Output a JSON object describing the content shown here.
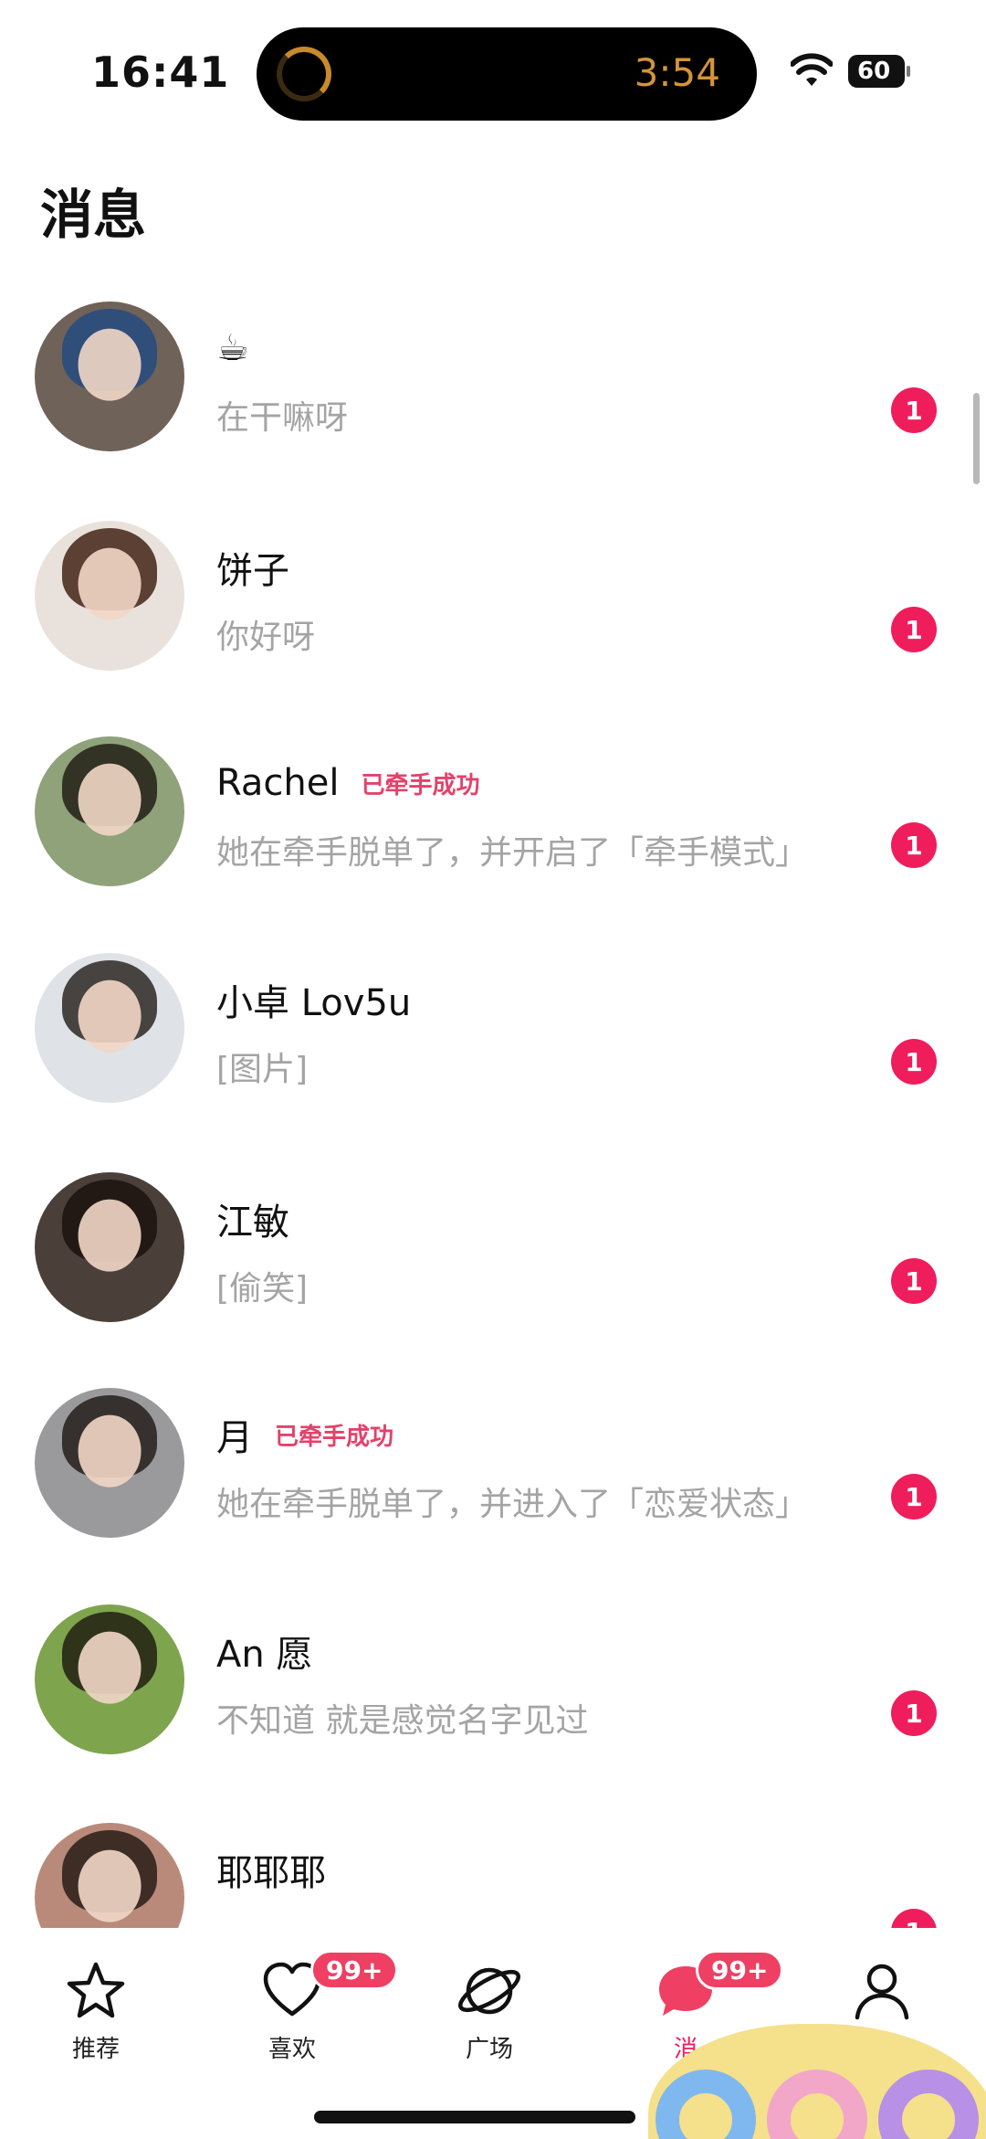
{
  "status_bar": {
    "time": "16:41",
    "live_activity_timer": "3:54",
    "battery_level": "60",
    "wifi_icon": "wifi-icon"
  },
  "header": {
    "title": "消息"
  },
  "conversations": [
    {
      "name": "",
      "name_emoji": "☕",
      "tag": "",
      "preview": "在干嘛呀",
      "unread": "1",
      "avatar_color": "#6f6259"
    },
    {
      "name": "饼子",
      "name_emoji": "",
      "tag": "",
      "preview": "你好呀",
      "unread": "1",
      "avatar_color": "#e9e2dc"
    },
    {
      "name": "Rachel",
      "name_emoji": "",
      "tag": "已牵手成功",
      "preview": "她在牵手脱单了，并开启了「牵手模式」",
      "unread": "1",
      "avatar_color": "#8fa27a"
    },
    {
      "name": "小卓 Lov5u",
      "name_emoji": "",
      "tag": "",
      "preview": "[图片]",
      "unread": "1",
      "avatar_color": "#dfe2e6"
    },
    {
      "name": "江敏",
      "name_emoji": "",
      "tag": "",
      "preview": "[偷笑]",
      "unread": "1",
      "avatar_color": "#4b3f3a"
    },
    {
      "name": "月",
      "name_emoji": "",
      "tag": "已牵手成功",
      "preview": "她在牵手脱单了，并进入了「恋爱状态」",
      "unread": "1",
      "avatar_color": "#9a9a9c"
    },
    {
      "name": "An 愿",
      "name_emoji": "",
      "tag": "",
      "preview": "不知道 就是感觉名字见过",
      "unread": "1",
      "avatar_color": "#7fa44e"
    },
    {
      "name": "耶耶耶",
      "name_emoji": "",
      "tag": "",
      "preview": "",
      "unread": "1",
      "avatar_color": "#b98a7a"
    }
  ],
  "tab_bar": {
    "tabs": [
      {
        "label": "推荐",
        "icon": "star-icon",
        "badge": ""
      },
      {
        "label": "喜欢",
        "icon": "heart-icon",
        "badge": "99+"
      },
      {
        "label": "广场",
        "icon": "planet-icon",
        "badge": ""
      },
      {
        "label": "消",
        "icon": "chat-bubble-icon",
        "badge": "99+"
      },
      {
        "label": "",
        "icon": "profile-icon",
        "badge": ""
      }
    ],
    "active_color": "#ef1d5c"
  },
  "colors": {
    "unread_badge": "#ef1d5c",
    "tag_text": "#e3426b",
    "preview_text": "#a4a4a4"
  }
}
